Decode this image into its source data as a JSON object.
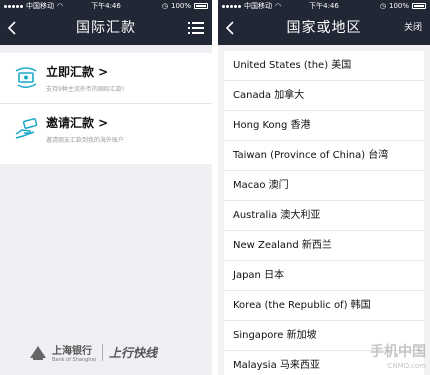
{
  "left": {
    "status": {
      "carrier": "中国移动",
      "time": "下午4:46",
      "battery": "100%"
    },
    "nav": {
      "title": "国际汇款"
    },
    "items": [
      {
        "title": "立即汇款 >",
        "subtitle": "支持9种主流外币的国际汇款!"
      },
      {
        "title": "邀请汇款 >",
        "subtitle": "邀请朋友汇款到我的海外账户"
      }
    ],
    "footer": {
      "bank_cn": "上海银行",
      "bank_en": "Bank of Shanghai",
      "brand": "上行快线"
    }
  },
  "right": {
    "status": {
      "carrier": "中国移动",
      "time": "下午4:46",
      "battery": "100%"
    },
    "nav": {
      "title": "国家或地区",
      "close": "关闭"
    },
    "countries": [
      "United States (the)  美国",
      "Canada  加拿大",
      "Hong Kong  香港",
      "Taiwan (Province of China)  台湾",
      "Macao  澳门",
      "Australia  澳大利亚",
      "New Zealand  新西兰",
      "Japan  日本",
      "Korea (the Republic of)  韩国",
      "Singapore  新加坡",
      "Malaysia  马来西亚"
    ]
  },
  "watermark": {
    "main": "手机中国",
    "sub": "CNMO.com"
  },
  "colors": {
    "navbar": "#222735",
    "accent_icon": "#1aa8c8"
  }
}
